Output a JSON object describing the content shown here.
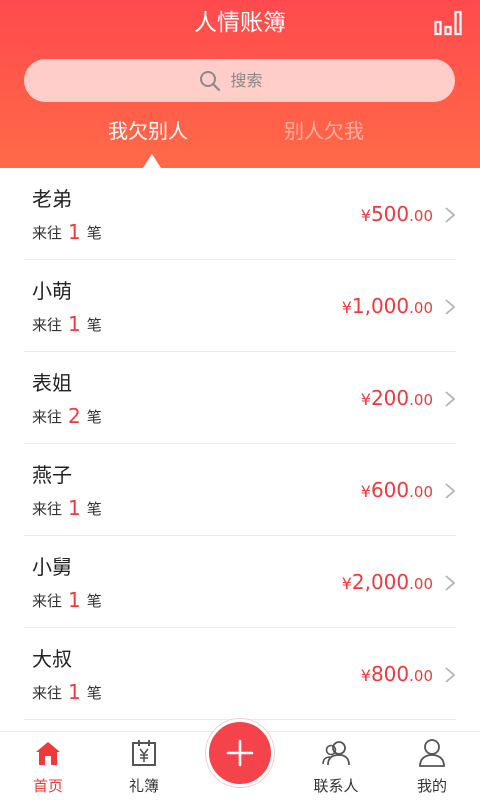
{
  "header": {
    "title": "人情账簿",
    "stats_icon": "bar-chart-icon",
    "search_placeholder": "搜索",
    "tabs": [
      {
        "label": "我欠别人",
        "active": true
      },
      {
        "label": "别人欠我",
        "active": false
      }
    ]
  },
  "list": {
    "count_prefix": "来往",
    "count_suffix": "笔",
    "items": [
      {
        "name": "老弟",
        "count": "1",
        "currency": "¥",
        "amount_int": "500",
        "amount_dec": ".00"
      },
      {
        "name": "小萌",
        "count": "1",
        "currency": "¥",
        "amount_int": "1,000",
        "amount_dec": ".00"
      },
      {
        "name": "表姐",
        "count": "2",
        "currency": "¥",
        "amount_int": "200",
        "amount_dec": ".00"
      },
      {
        "name": "燕子",
        "count": "1",
        "currency": "¥",
        "amount_int": "600",
        "amount_dec": ".00"
      },
      {
        "name": "小舅",
        "count": "1",
        "currency": "¥",
        "amount_int": "2,000",
        "amount_dec": ".00"
      },
      {
        "name": "大叔",
        "count": "1",
        "currency": "¥",
        "amount_int": "800",
        "amount_dec": ".00"
      }
    ]
  },
  "bottom_nav": {
    "items": [
      {
        "label": "首页",
        "icon": "home-icon",
        "active": true
      },
      {
        "label": "礼簿",
        "icon": "gift-book-icon",
        "active": false
      },
      {
        "label": "联系人",
        "icon": "contacts-icon",
        "active": false
      },
      {
        "label": "我的",
        "icon": "user-icon",
        "active": false
      }
    ],
    "add_icon": "plus-icon"
  },
  "colors": {
    "accent": "#ff4a4d",
    "amount": "#ee3a3a",
    "tab_inactive": "#ffb0a3"
  }
}
